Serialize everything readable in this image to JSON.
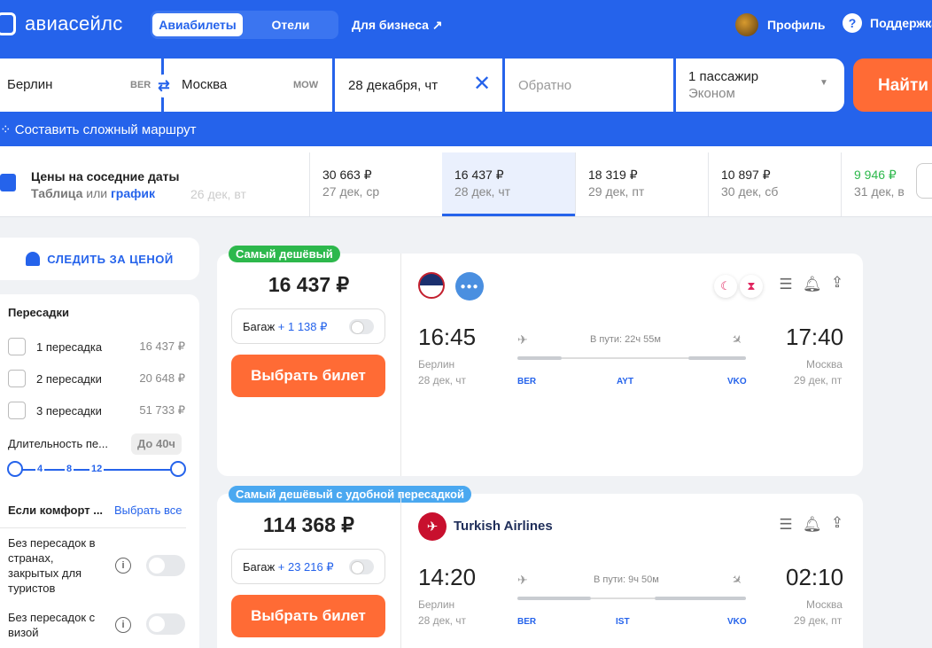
{
  "header": {
    "logo_text": "авиасейлс",
    "tabs": [
      "Авиабилеты",
      "Отели"
    ],
    "business_link": "Для бизнеса ↗",
    "profile": "Профиль",
    "support": "Поддержка"
  },
  "search": {
    "from_city": "Берлин",
    "from_code": "BER",
    "to_city": "Москва",
    "to_code": "MOW",
    "depart_date": "28 декабря, чт",
    "return_placeholder": "Обратно",
    "passengers": "1 пассажир",
    "cabin": "Эконом",
    "find_button": "Найти",
    "complex_route": "Составить сложный маршрут"
  },
  "date_strip": {
    "title": "Цены на соседние даты",
    "subtitle_table": "Таблица",
    "subtitle_or": " или ",
    "subtitle_chart": "график",
    "ghost_date": "26 дек, вт",
    "cells": [
      {
        "price": "30 663 ₽",
        "date": "27 дек, ср"
      },
      {
        "price": "16 437 ₽",
        "date": "28 дек, чт"
      },
      {
        "price": "18 319 ₽",
        "date": "29 дек, пт"
      },
      {
        "price": "10 897 ₽",
        "date": "30 дек, сб"
      },
      {
        "price": "9 946 ₽",
        "date": "31 дек, в"
      }
    ]
  },
  "filters": {
    "track_price": "СЛЕДИТЬ ЗА ЦЕНОЙ",
    "stops_title": "Пересадки",
    "stops": [
      {
        "label": "1 пересадка",
        "price": "16 437 ₽"
      },
      {
        "label": "2 пересадки",
        "price": "20 648 ₽"
      },
      {
        "label": "3 пересадки",
        "price": "51 733 ₽"
      }
    ],
    "duration_label": "Длительность пе...",
    "duration_value": "До 40ч",
    "duration_ticks": [
      "4",
      "8",
      "12"
    ],
    "comfort_title": "Если комфорт ...",
    "comfort_select_all": "Выбрать все",
    "comfort_items": [
      {
        "label": "Без пересадок в странах, закрытых для туристов",
        "enabled": false
      },
      {
        "label": "Без пересадок с визой",
        "enabled": false
      }
    ]
  },
  "tickets": [
    {
      "badge": "Самый дешёвый",
      "badge_color": "#2db84c",
      "price": "16 437 ₽",
      "baggage_label": "Багаж",
      "baggage_extra": "+ 1 138 ₽",
      "buy_button": "Выбрать билет",
      "depart_time": "16:45",
      "depart_city": "Берлин",
      "depart_date": "28 дек, чт",
      "arrive_time": "17:40",
      "arrive_city": "Москва",
      "arrive_date": "29 дек, пт",
      "duration": "В пути: 22ч 55м",
      "codes": [
        "BER",
        "AYT",
        "VKO"
      ]
    },
    {
      "badge": "Самый дешёвый с удобной пересадкой",
      "badge_color": "#4aa8f0",
      "price": "114 368 ₽",
      "airline": "Turkish Airlines",
      "baggage_label": "Багаж",
      "baggage_extra": "+ 23 216 ₽",
      "buy_button": "Выбрать билет",
      "depart_time": "14:20",
      "depart_city": "Берлин",
      "depart_date": "28 дек, чт",
      "arrive_time": "02:10",
      "arrive_city": "Москва",
      "arrive_date": "29 дек, пт",
      "duration": "В пути: 9ч 50м",
      "codes": [
        "BER",
        "IST",
        "VKO"
      ]
    }
  ],
  "colors": {
    "brand_blue": "#2563eb",
    "accent_orange": "#ff6b35",
    "green": "#2db84c"
  }
}
